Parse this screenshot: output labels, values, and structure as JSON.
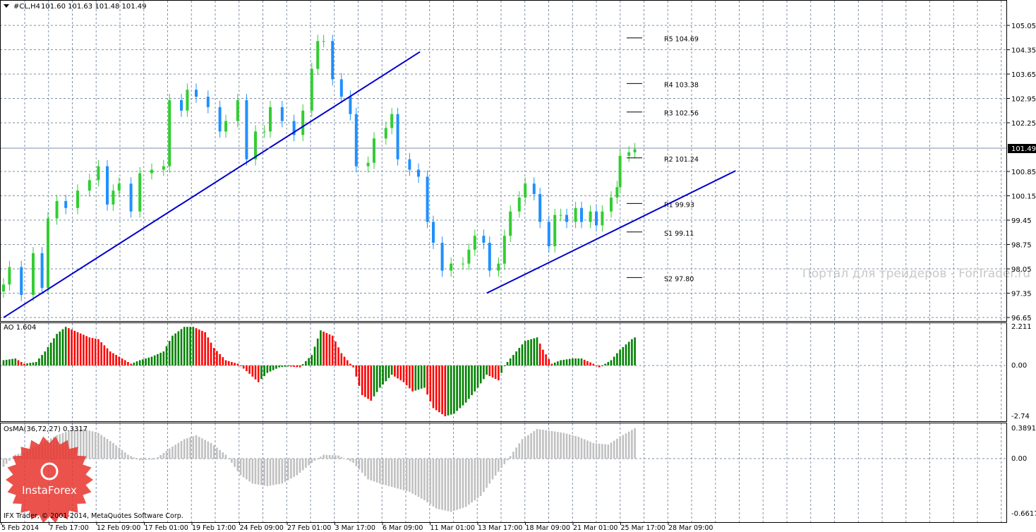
{
  "header": {
    "symbol": "#CL,H4",
    "ohlc": "101.60 101.63 101.48 101.49"
  },
  "ao_label": "AO 1.604",
  "osma_label": "OsMA(36,72,27) 0.3317",
  "copyright": "IFX Trader, © 2001-2014, MetaQuotes Software Corp.",
  "watermark": "Портал для трейдеров - ForTrader.ru",
  "logo_text": "InstaForex",
  "colors": {
    "bull": "#32CD32",
    "bear": "#1E90FF",
    "ao_up": "#008000",
    "ao_down": "#FF0000",
    "osma": "#C0C0C0",
    "trendline": "#0000CD",
    "grid": "#7d8fa8"
  },
  "chart_data": [
    {
      "type": "candlestick",
      "title": "#CL,H4",
      "current_price": "101.49",
      "ylim": [
        96.65,
        105.05
      ],
      "yticks": [
        "105.05",
        "104.35",
        "103.65",
        "102.95",
        "102.25",
        "100.85",
        "100.15",
        "99.45",
        "98.75",
        "98.05",
        "97.35",
        "96.65"
      ],
      "xticks": [
        "5 Feb 2014",
        "7 Feb 17:00",
        "12 Feb 09:00",
        "17 Feb 01:00",
        "19 Feb 17:00",
        "24 Feb 09:00",
        "27 Feb 01:00",
        "3 Mar 17:00",
        "6 Mar 09:00",
        "11 Mar 01:00",
        "13 Mar 17:00",
        "18 Mar 09:00",
        "21 Mar 01:00",
        "25 Mar 17:00",
        "28 Mar 09:00"
      ],
      "bars": [
        0,
        2,
        6,
        10,
        13,
        15,
        18,
        21,
        25,
        29,
        32,
        35,
        37,
        39,
        43,
        46,
        50,
        54,
        56,
        60,
        62,
        65,
        69,
        73,
        75,
        79,
        82,
        85,
        88,
        90,
        94,
        98,
        101,
        104,
        106,
        108,
        111,
        114,
        117,
        119,
        123,
        125,
        129,
        131,
        133,
        137,
        140,
        143,
        145,
        148,
        151,
        155,
        157,
        159,
        162,
        164,
        167,
        169,
        171,
        174,
        176,
        179,
        181,
        184,
        186,
        188,
        190,
        193,
        195,
        198,
        200,
        202,
        205,
        207,
        208,
        211,
        213
      ],
      "close": [
        97.6,
        98.1,
        97.3,
        98.5,
        97.5,
        99.5,
        100.0,
        99.8,
        100.3,
        100.6,
        101.0,
        99.9,
        100.3,
        100.5,
        99.7,
        100.8,
        100.9,
        101.0,
        102.9,
        102.6,
        103.2,
        103.0,
        102.7,
        102.0,
        102.3,
        102.9,
        101.2,
        102.0,
        102.0,
        102.7,
        102.3,
        101.9,
        102.6,
        103.8,
        104.6,
        104.6,
        103.5,
        103.0,
        102.5,
        101.0,
        101.1,
        101.8,
        102.1,
        102.5,
        101.2,
        100.9,
        100.7,
        99.4,
        98.8,
        98.0,
        98.2,
        98.2,
        98.6,
        99.0,
        98.8,
        98.0,
        98.2,
        99.0,
        99.7,
        100.1,
        100.5,
        100.2,
        99.4,
        98.7,
        99.6,
        99.6,
        99.4,
        99.8,
        99.4,
        99.7,
        99.3,
        99.7,
        100.1,
        100.4,
        101.3,
        101.4,
        101.49
      ],
      "trendlines": [
        {
          "from": [
            0,
            96.65
          ],
          "to": [
            140.5,
            104.29
          ]
        },
        {
          "from": [
            163,
            97.35
          ],
          "to": [
            247,
            100.87
          ]
        }
      ],
      "pivots": [
        {
          "label": "R5 104.69",
          "value": 104.69
        },
        {
          "label": "R4 103.38",
          "value": 103.38
        },
        {
          "label": "R3 102.56",
          "value": 102.56
        },
        {
          "label": "R2 101.24",
          "value": 101.24
        },
        {
          "label": "R1 99.93",
          "value": 99.93
        },
        {
          "label": "S1 99.11",
          "value": 99.11
        },
        {
          "label": "S2 97.80",
          "value": 97.8
        }
      ]
    },
    {
      "type": "bar",
      "title": "AO 1.604",
      "ylim": [
        -2.74,
        2.211
      ],
      "yticks": [
        "2.211",
        "0.00",
        "-2.74"
      ],
      "bars": [
        0,
        4,
        7,
        11,
        14,
        18,
        21,
        25,
        29,
        32,
        36,
        39,
        43,
        46,
        50,
        54,
        57,
        61,
        64,
        68,
        71,
        75,
        79,
        82,
        86,
        89,
        93,
        96,
        100,
        104,
        107,
        111,
        114,
        118,
        121,
        124,
        127,
        131,
        135,
        138,
        142,
        145,
        149,
        152,
        156,
        160,
        163,
        167,
        169,
        173,
        176,
        180,
        182,
        185,
        188,
        192,
        195,
        199,
        201,
        205,
        208,
        212,
        213
      ],
      "values": [
        0.3,
        0.4,
        0.1,
        0.2,
        0.8,
        1.8,
        2.2,
        1.9,
        1.6,
        1.5,
        0.8,
        0.5,
        0.1,
        0.3,
        0.5,
        0.8,
        1.7,
        2.2,
        2.2,
        1.9,
        1.0,
        0.3,
        0.1,
        -0.3,
        -0.9,
        -0.4,
        -0.1,
        -0.05,
        -0.1,
        0.6,
        2.0,
        1.7,
        0.7,
        -0.1,
        -1.6,
        -1.9,
        -1.2,
        -0.5,
        -0.9,
        -1.4,
        -1.2,
        -2.3,
        -2.74,
        -2.6,
        -2.0,
        -1.2,
        -0.5,
        -0.8,
        0.0,
        0.8,
        1.4,
        1.6,
        0.9,
        0.1,
        0.3,
        0.4,
        0.4,
        0.1,
        -0.1,
        0.3,
        0.9,
        1.5,
        1.6
      ]
    },
    {
      "type": "bar",
      "title": "OsMA(36,72,27) 0.3317",
      "ylim": [
        -0.6617,
        0.3891
      ],
      "yticks": [
        "0.3891",
        "0.00",
        "-0.6617"
      ],
      "bars": [
        0,
        4,
        8,
        13,
        18,
        23,
        27,
        32,
        37,
        42,
        46,
        51,
        56,
        61,
        65,
        70,
        75,
        80,
        84,
        89,
        94,
        99,
        104,
        108,
        113,
        118,
        123,
        127,
        132,
        137,
        142,
        146,
        151,
        156,
        161,
        165,
        170,
        175,
        180,
        184,
        189,
        194,
        199,
        204,
        208,
        213
      ],
      "values": [
        -0.1,
        0.05,
        0.1,
        0.2,
        0.3,
        0.37,
        0.38,
        0.33,
        0.2,
        0.05,
        -0.02,
        -0.01,
        0.13,
        0.25,
        0.3,
        0.2,
        0.05,
        -0.2,
        -0.3,
        -0.33,
        -0.3,
        -0.2,
        -0.05,
        0.05,
        0.04,
        -0.05,
        -0.25,
        -0.3,
        -0.35,
        -0.4,
        -0.5,
        -0.6,
        -0.64,
        -0.58,
        -0.45,
        -0.25,
        -0.02,
        0.25,
        0.38,
        0.36,
        0.33,
        0.28,
        0.2,
        0.18,
        0.28,
        0.39
      ]
    }
  ]
}
